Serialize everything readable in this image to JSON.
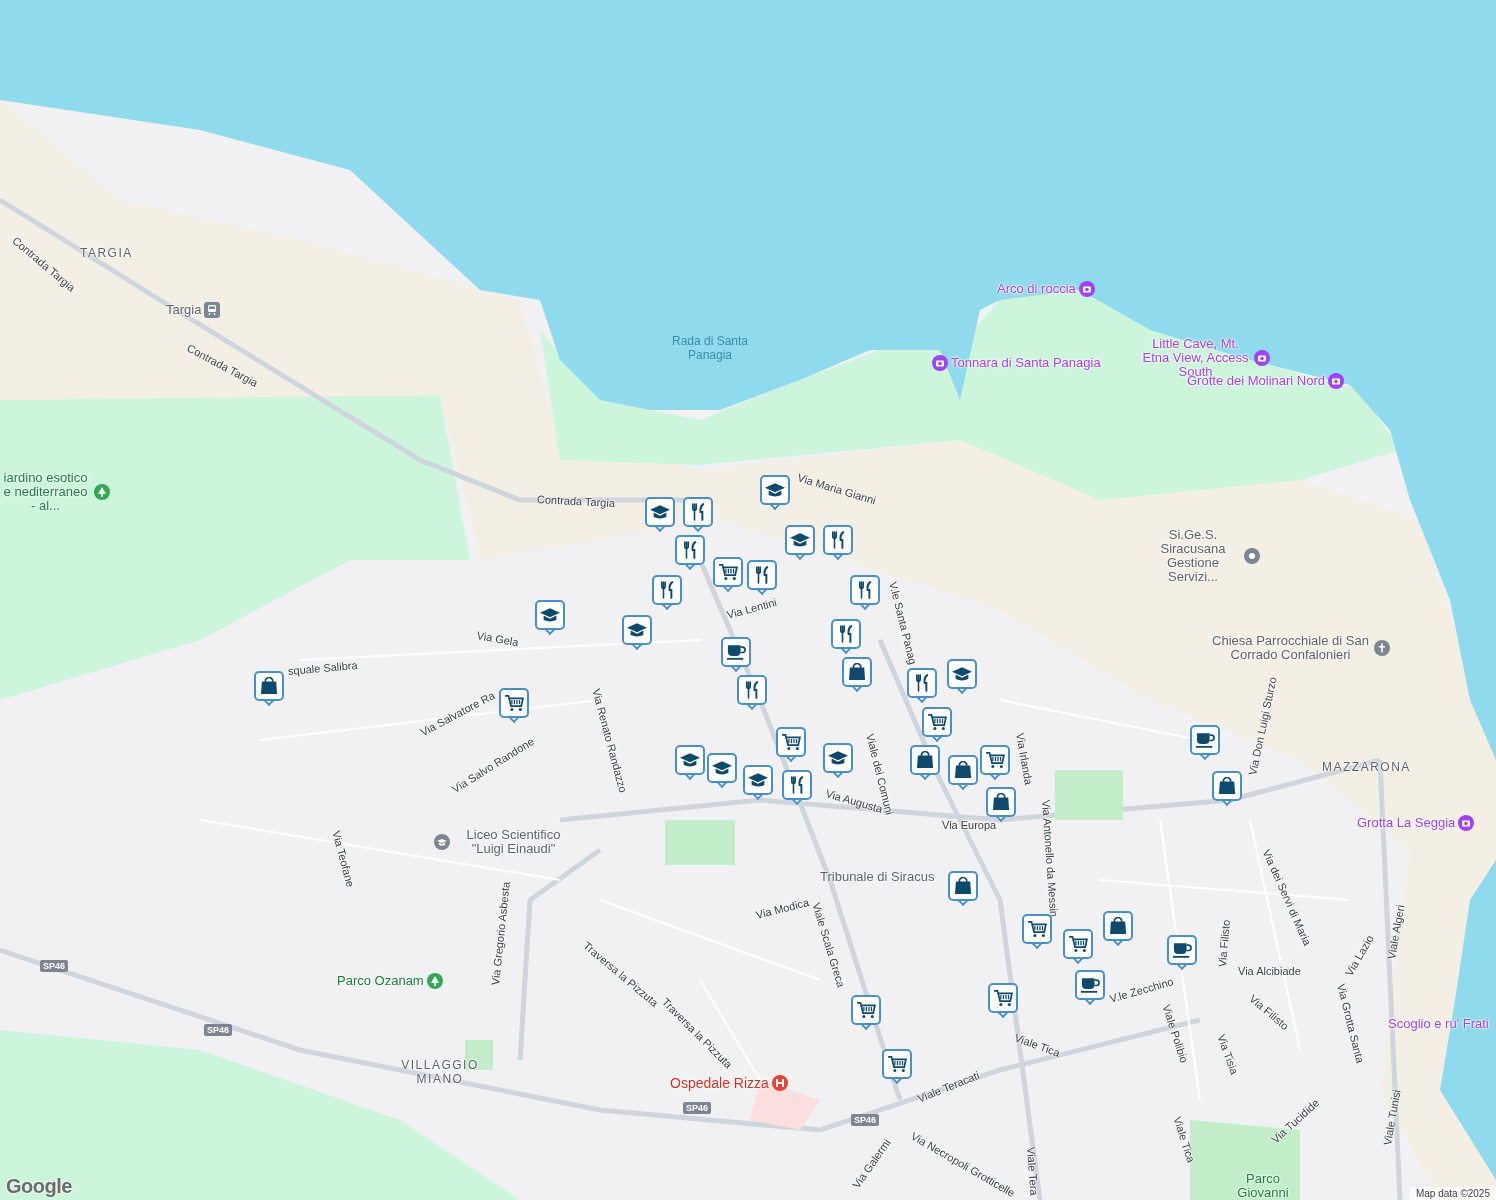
{
  "map": {
    "labels": [
      {
        "kind": "district",
        "text": "TARGIA"
      },
      {
        "kind": "station",
        "text": "Targia"
      },
      {
        "kind": "street",
        "text": "Contrada Targia"
      },
      {
        "kind": "street",
        "text": "Contrada Targia"
      },
      {
        "kind": "street",
        "text": "Contrada Targia"
      },
      {
        "kind": "water",
        "text": "Rada di Santa Panagia"
      },
      {
        "kind": "attraction",
        "text": "Arco di roccia"
      },
      {
        "kind": "attraction-left",
        "text": "Tonnara di Santa Panagia"
      },
      {
        "kind": "attraction",
        "text": "Little Cave, Mt. Etna View, Access South"
      },
      {
        "kind": "attraction",
        "text": "Grotte dei Molinari Nord"
      },
      {
        "kind": "park",
        "text": "iardino esotico e nediterraneo - al..."
      },
      {
        "kind": "landmark",
        "text": "Si.Ge.S. Siracusana Gestione Servizi..."
      },
      {
        "kind": "church",
        "text": "Chiesa Parrocchiale di San Corrado Confalonieri"
      },
      {
        "kind": "district",
        "text": "MAZZARONA"
      },
      {
        "kind": "attraction",
        "text": "Grotta La Seggia"
      },
      {
        "kind": "attraction-plain",
        "text": "Scoglio e ru' Frati"
      },
      {
        "kind": "school",
        "text": "Liceo Scientifico \"Luigi Einaudi\""
      },
      {
        "kind": "courthouse",
        "text": "Tribunale di Siracus"
      },
      {
        "kind": "park",
        "text": "Parco Ozanam"
      },
      {
        "kind": "district",
        "text": "VILLAGGIO MIANO"
      },
      {
        "kind": "hospital",
        "text": "Ospedale Rizza"
      },
      {
        "kind": "park-plain",
        "text": "Parco Giovanni"
      },
      {
        "kind": "street",
        "text": "Via Maria Gianni"
      },
      {
        "kind": "street",
        "text": "Via Lentini"
      },
      {
        "kind": "street",
        "text": "Via Gela"
      },
      {
        "kind": "street",
        "text": "squale Salibra"
      },
      {
        "kind": "street",
        "text": "Via Salvatore Ra"
      },
      {
        "kind": "street",
        "text": "Via Salvo Randone"
      },
      {
        "kind": "street",
        "text": "Via Renato Randazzo"
      },
      {
        "kind": "street",
        "text": "Via Teofane"
      },
      {
        "kind": "street",
        "text": "Via Gregorio Asbesta"
      },
      {
        "kind": "street",
        "text": "Via Augusta"
      },
      {
        "kind": "street",
        "text": "Via Europa"
      },
      {
        "kind": "street",
        "text": "Viale dei Comuni"
      },
      {
        "kind": "street",
        "text": "V.le Santa Panag"
      },
      {
        "kind": "street",
        "text": "Via Irlanda"
      },
      {
        "kind": "street",
        "text": "Via Antonello da Messin"
      },
      {
        "kind": "street",
        "text": "Via Don Luigi Sturzo"
      },
      {
        "kind": "street",
        "text": "Via dei Servi di Maria"
      },
      {
        "kind": "street",
        "text": "Via Modica"
      },
      {
        "kind": "street",
        "text": "Viale Scala Greca"
      },
      {
        "kind": "street",
        "text": "Traversa la Pizzuta"
      },
      {
        "kind": "street",
        "text": "Traversa la Pizzuta"
      },
      {
        "kind": "street",
        "text": "Viale Tica"
      },
      {
        "kind": "street",
        "text": "Viale Tica"
      },
      {
        "kind": "street",
        "text": "V.le Zecchino"
      },
      {
        "kind": "street",
        "text": "Viale Polibio"
      },
      {
        "kind": "street",
        "text": "Via Tisia"
      },
      {
        "kind": "street",
        "text": "Via Filisto"
      },
      {
        "kind": "street",
        "text": "Via Filisto"
      },
      {
        "kind": "street",
        "text": "Via Alcibiade"
      },
      {
        "kind": "street",
        "text": "Via Lazio"
      },
      {
        "kind": "street",
        "text": "Via Grotta Santa"
      },
      {
        "kind": "street",
        "text": "Viale Algeri"
      },
      {
        "kind": "street",
        "text": "Viale Teracati"
      },
      {
        "kind": "street",
        "text": "Via Necropoli Grotticelle"
      },
      {
        "kind": "street",
        "text": "Via Galermi"
      },
      {
        "kind": "street",
        "text": "Via Tucidide"
      },
      {
        "kind": "street",
        "text": "Viale Tunisi"
      },
      {
        "kind": "street",
        "text": "Viale Tera"
      },
      {
        "kind": "shield",
        "text": "SP46"
      },
      {
        "kind": "shield",
        "text": "SP46"
      },
      {
        "kind": "shield",
        "text": "SP46"
      },
      {
        "kind": "shield",
        "text": "SP46"
      }
    ],
    "markers": [
      {
        "kind": "school"
      },
      {
        "kind": "school"
      },
      {
        "kind": "restaurant"
      },
      {
        "kind": "restaurant"
      },
      {
        "kind": "cart"
      },
      {
        "kind": "restaurant"
      },
      {
        "kind": "school"
      },
      {
        "kind": "restaurant"
      },
      {
        "kind": "restaurant"
      },
      {
        "kind": "restaurant"
      },
      {
        "kind": "school"
      },
      {
        "kind": "school"
      },
      {
        "kind": "cafe"
      },
      {
        "kind": "restaurant"
      },
      {
        "kind": "bag"
      },
      {
        "kind": "restaurant"
      },
      {
        "kind": "restaurant"
      },
      {
        "kind": "school"
      },
      {
        "kind": "cart"
      },
      {
        "kind": "bag"
      },
      {
        "kind": "cart"
      },
      {
        "kind": "school"
      },
      {
        "kind": "school"
      },
      {
        "kind": "school"
      },
      {
        "kind": "restaurant"
      },
      {
        "kind": "cart"
      },
      {
        "kind": "school"
      },
      {
        "kind": "bag"
      },
      {
        "kind": "bag"
      },
      {
        "kind": "cart"
      },
      {
        "kind": "bag"
      },
      {
        "kind": "cafe"
      },
      {
        "kind": "bag"
      },
      {
        "kind": "bag"
      },
      {
        "kind": "cart"
      },
      {
        "kind": "cart"
      },
      {
        "kind": "bag"
      },
      {
        "kind": "cafe"
      },
      {
        "kind": "cafe"
      },
      {
        "kind": "cart"
      },
      {
        "kind": "cart"
      },
      {
        "kind": "cart"
      }
    ],
    "attribution": "Map data ©2025",
    "logo": "Google"
  }
}
